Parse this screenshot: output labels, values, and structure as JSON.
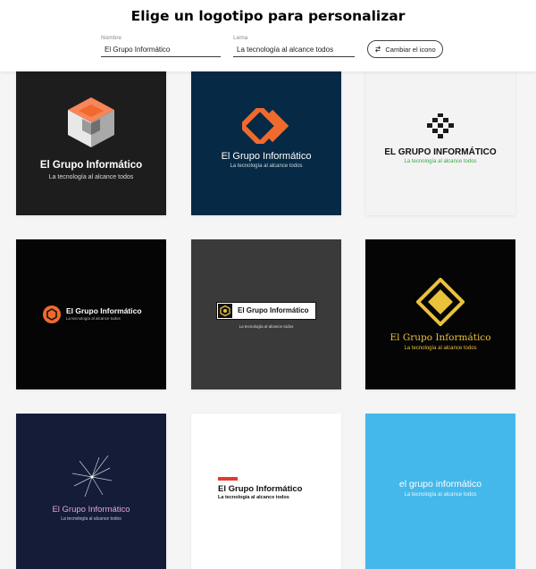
{
  "header": {
    "title": "Elige un logotipo para personalizar",
    "name_label": "Nombre",
    "name_value": "El Grupo Informático",
    "slogan_label": "Lema",
    "slogan_value": "La tecnología al alcance todos",
    "change_icon_label": "Cambiar el icono"
  },
  "logos": [
    {
      "name": "El Grupo Informático",
      "slogan": "La tecnología al alcance todos"
    },
    {
      "name": "El Grupo Informático",
      "slogan": "La tecnología al alcance todos"
    },
    {
      "name": "EL GRUPO INFORMÁTICO",
      "slogan": "La tecnología al alcance todos"
    },
    {
      "name": "El Grupo Informático",
      "slogan": "La tecnología al alcance todos"
    },
    {
      "name": "El Grupo Informático",
      "slogan": "La tecnología al alcance todos"
    },
    {
      "name": "El Grupo Informático",
      "slogan": "La tecnología al alcance todos"
    },
    {
      "name": "El Grupo Informático",
      "slogan": "La tecnología al alcance todos"
    },
    {
      "name": "El Grupo Informático",
      "slogan": "La tecnología al alcance todos"
    },
    {
      "name": "el grupo informático",
      "slogan": "La tecnología al alcance todos"
    }
  ],
  "colors": {
    "tile1_bg": "#1d1d1d",
    "tile2_bg": "#062a45",
    "tile3_bg": "#f3f3f4",
    "tile4_bg": "#050505",
    "tile5_bg": "#3a3a3a",
    "tile6_bg": "#050505",
    "tile7_bg": "#141c38",
    "tile8_bg": "#ffffff",
    "tile9_bg": "#44b8ea",
    "orange": "#f06a2d",
    "gold": "#e9c13b",
    "green": "#3aa844",
    "red": "#e63a2e"
  },
  "icons": [
    "isometric-cube-icon",
    "chevron-diamond-icon",
    "pixel-diamond-icon",
    "hexagon-emblem-icon",
    "hexagon-emblem-icon",
    "nested-diamond-icon",
    "starburst-icon",
    "red-bar-icon"
  ]
}
